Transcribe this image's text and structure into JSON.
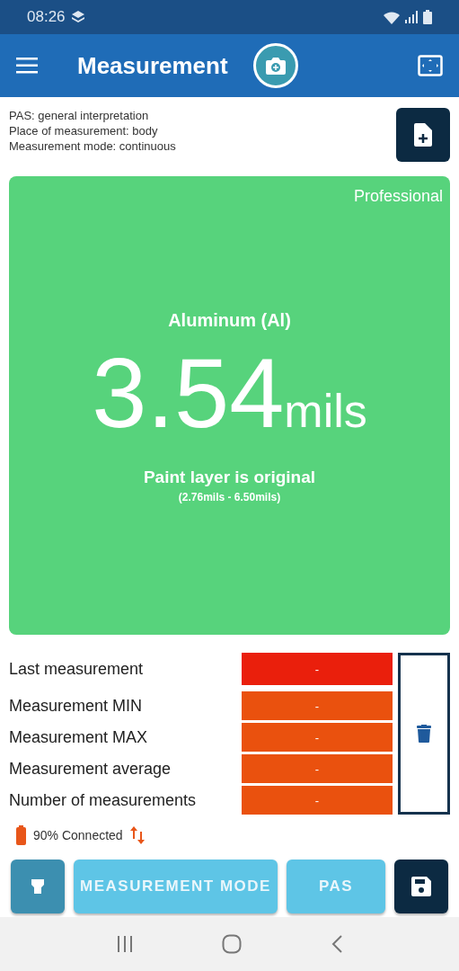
{
  "status_bar": {
    "time": "08:26"
  },
  "app_bar": {
    "title": "Measurement"
  },
  "info": {
    "lines": [
      "PAS: general interpretation",
      "Place of measurement: body",
      "Measurement mode: continuous"
    ]
  },
  "result": {
    "badge": "Professional",
    "material": "Aluminum (Al)",
    "value": "3.54",
    "unit": "mils",
    "verdict": "Paint layer is original",
    "range": "(2.76mils - 6.50mils)",
    "color": "#57d37c"
  },
  "stats": [
    {
      "label": "Last measurement",
      "value": "-",
      "color": "#ea1f0c"
    },
    {
      "label": "Measurement MIN",
      "value": "-",
      "color": "#ea510e"
    },
    {
      "label": "Measurement MAX",
      "value": "-",
      "color": "#ea510e"
    },
    {
      "label": "Measurement average",
      "value": "-",
      "color": "#ea510e"
    },
    {
      "label": "Number of measurements",
      "value": "-",
      "color": "#ea510e"
    }
  ],
  "connection": {
    "text": "90% Connected"
  },
  "buttons": [
    {
      "kind": "probe"
    },
    {
      "kind": "text",
      "label": "MEASUREMENT MODE"
    },
    {
      "kind": "text",
      "label": "PAS"
    },
    {
      "kind": "save"
    }
  ]
}
